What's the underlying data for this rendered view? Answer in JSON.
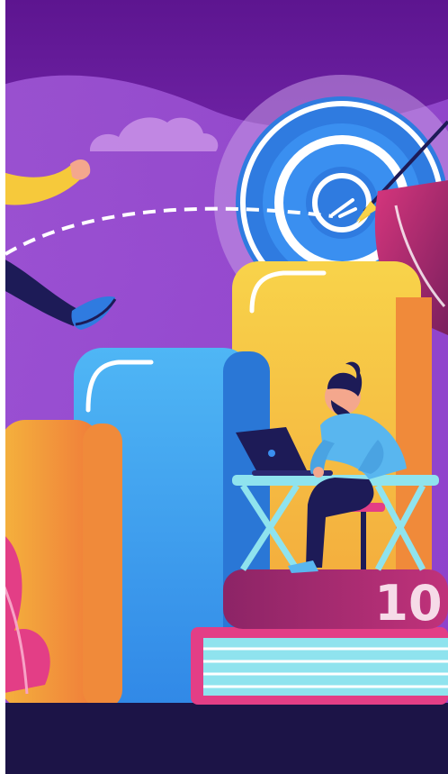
{
  "illustration": {
    "subject": "person-working-at-laptop-on-books-aiming-at-target",
    "book_label": "10",
    "colors": {
      "sky_top": "#6a1a9e",
      "sky_mid": "#8a3fc6",
      "floor": "#1c1447",
      "blue_block": "#3fa7ee",
      "yellow_block": "#f6c93b",
      "orange_block": "#f08a3a",
      "target_blue": "#2f7be0",
      "magenta": "#b5266e",
      "person_shirt": "#59b6ef",
      "person_pants": "#1d1b57",
      "desk": "#8fe3ee",
      "pink_plant": "#e33e86"
    }
  }
}
